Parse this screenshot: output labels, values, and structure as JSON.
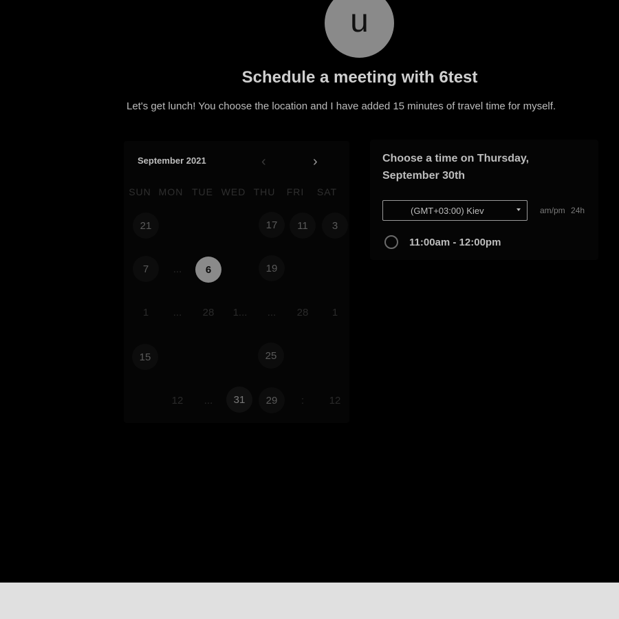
{
  "profile": {
    "initial": "u"
  },
  "header": {
    "title": "Schedule a meeting with 6test",
    "description": "Let's get lunch! You choose the location and I have added 15 minutes of travel time for myself."
  },
  "calendar": {
    "month_label": "September 2021",
    "prev_icon": "‹",
    "next_icon": "›",
    "weekdays": [
      "SUN",
      "MON",
      "TUE",
      "WED",
      "THU",
      "FRI",
      "SAT"
    ],
    "cells": [
      {
        "label": "21",
        "state": "normal"
      },
      {
        "label": "17",
        "state": "normal"
      },
      {
        "label": "11",
        "state": "normal"
      },
      {
        "label": "3",
        "state": "normal"
      },
      {
        "label": "7",
        "state": "normal"
      },
      {
        "label": "...",
        "state": "dim"
      },
      {
        "label": "6",
        "state": "selected"
      },
      {
        "label": "19",
        "state": "normal"
      },
      {
        "label": "1",
        "state": "dim"
      },
      {
        "label": "...",
        "state": "dim"
      },
      {
        "label": "28",
        "state": "dim"
      },
      {
        "label": "1...",
        "state": "dim"
      },
      {
        "label": "...",
        "state": "dim"
      },
      {
        "label": "28",
        "state": "dim"
      },
      {
        "label": "1",
        "state": "dim"
      },
      {
        "label": "15",
        "state": "normal"
      },
      {
        "label": "25",
        "state": "normal"
      },
      {
        "label": "12",
        "state": "dim"
      },
      {
        "label": "...",
        "state": "dim"
      },
      {
        "label": "31",
        "state": "bright"
      },
      {
        "label": "29",
        "state": "normal"
      },
      {
        "label": ":",
        "state": "dim"
      },
      {
        "label": "12",
        "state": "dim"
      }
    ]
  },
  "times": {
    "heading": "Choose a time on Thursday, September 30th",
    "timezone": "(GMT+03:00) Kiev",
    "format_ampm": "am/pm",
    "format_24h": "24h",
    "slots": [
      {
        "label": "11:00am - 12:00pm"
      }
    ]
  }
}
